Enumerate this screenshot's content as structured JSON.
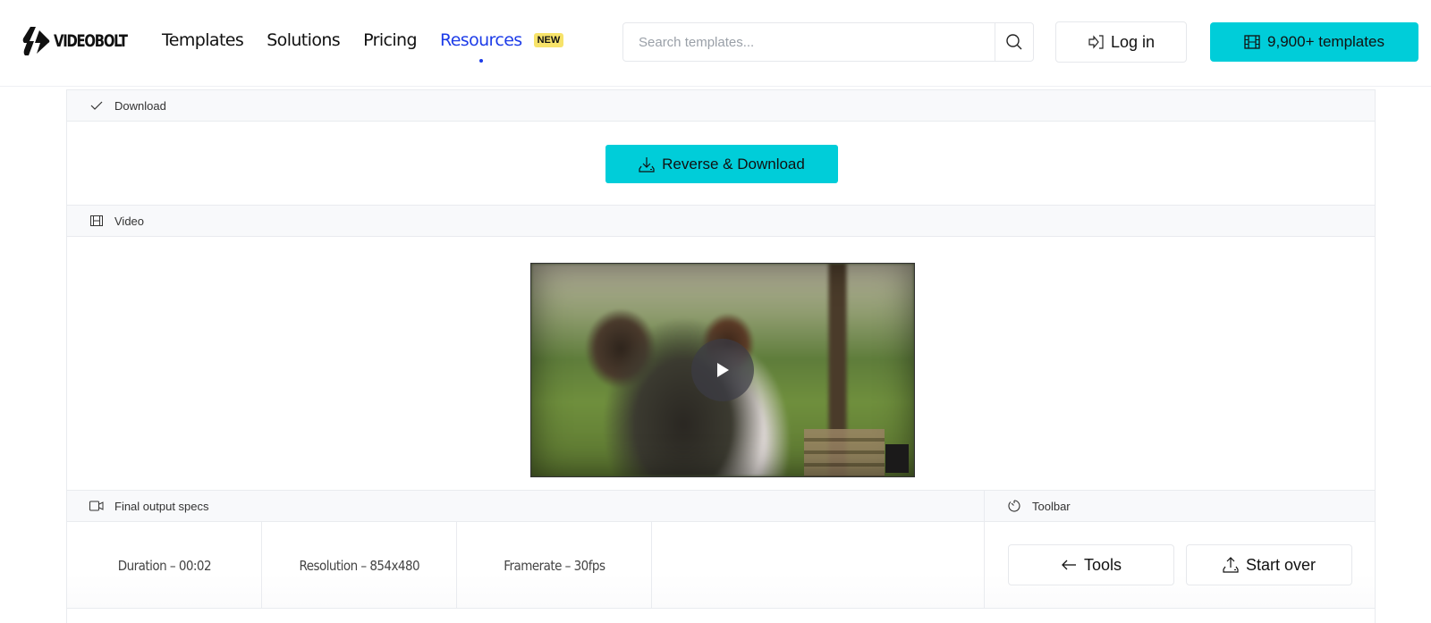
{
  "header": {
    "logo_text": "VIDEOBOLT",
    "nav": [
      {
        "label": "Templates",
        "active": false
      },
      {
        "label": "Solutions",
        "active": false
      },
      {
        "label": "Pricing",
        "active": false
      },
      {
        "label": "Resources",
        "active": true
      }
    ],
    "new_badge": "NEW",
    "search": {
      "placeholder": "Search templates...",
      "value": ""
    },
    "login_label": "Log in",
    "templates_label": "9,900+ templates"
  },
  "colors": {
    "accent": "#00cdd9",
    "nav_active": "#1d3ce8",
    "badge": "#f7e36a"
  },
  "sections": {
    "download": {
      "title": "Download",
      "icon": "check-icon",
      "button_label": "Reverse & Download"
    },
    "video": {
      "title": "Video",
      "icon": "film-icon"
    },
    "specs": {
      "title": "Final output specs",
      "icon": "video-camera-icon",
      "items": [
        "Duration – 00:02",
        "Resolution – 854x480",
        "Framerate – 30fps"
      ]
    },
    "toolbar": {
      "title": "Toolbar",
      "icon": "timer-icon",
      "tools_label": "Tools",
      "start_over_label": "Start over"
    }
  }
}
